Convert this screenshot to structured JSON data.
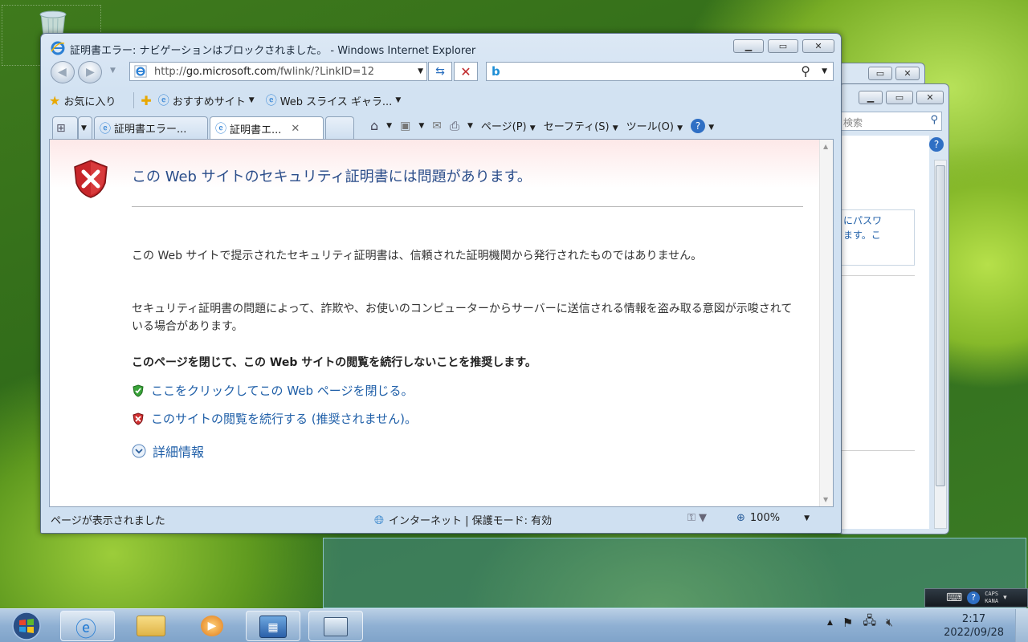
{
  "window": {
    "title": "証明書エラー: ナビゲーションはブロックされました。 - Windows Internet Explorer",
    "address_domain": "go.microsoft.com",
    "address_prefix": "http://",
    "address_path": "/fwlink/?LinkID=12"
  },
  "favorites_bar": {
    "favorites": "お気に入り",
    "suggested_sites": "おすすめサイト",
    "web_slice": "Web スライス ギャラ..."
  },
  "tabs": [
    {
      "label": "証明書エラー..."
    },
    {
      "label": "証明書エ..."
    }
  ],
  "command_bar": {
    "page": "ページ(P)",
    "safety": "セーフティ(S)",
    "tools": "ツール(O)"
  },
  "error_page": {
    "title": "この Web サイトのセキュリティ証明書には問題があります。",
    "para1": "この Web サイトで提示されたセキュリティ証明書は、信頼された証明機関から発行されたものではありません。",
    "para2": "セキュリティ証明書の問題によって、詐欺や、お使いのコンピューターからサーバーに送信される情報を盗み取る意図が示唆されている場合があります。",
    "recommendation": "このページを閉じて、この Web サイトの閲覧を続行しないことを推奨します。",
    "close_link": "ここをクリックしてこの Web ページを閉じる。",
    "continue_link": "このサイトの閲覧を続行する (推奨されません)。",
    "more_info": "詳細情報"
  },
  "status_bar": {
    "status": "ページが表示されました",
    "zone": "インターネット | 保護モード: 有効",
    "zoom": "100%"
  },
  "bg_window": {
    "search_fragment": "検索",
    "text_line1": "にパスワ",
    "text_line2": "ます。こ"
  },
  "langbar": {
    "caps": "CAPS",
    "kana": "KANA"
  },
  "clock": {
    "time": "2:17",
    "date": "2022/09/28"
  },
  "colors": {
    "link": "#1f5fa8",
    "title": "#2a4d8a",
    "error_red": "#c0282a"
  }
}
